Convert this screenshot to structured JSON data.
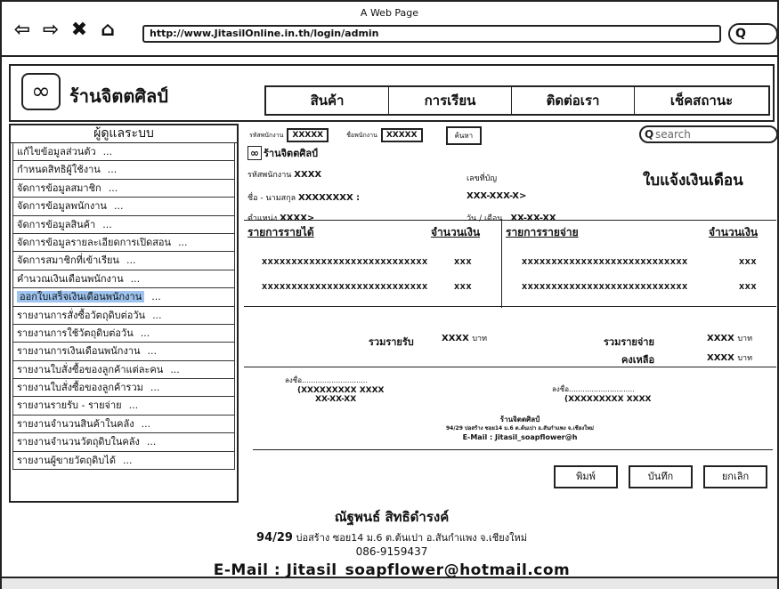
{
  "window": {
    "title": "A Web Page"
  },
  "browser": {
    "url": "http://www.JitasilOnline.in.th/login/admin",
    "back_icon": "back-arrow-icon",
    "forward_icon": "forward-arrow-icon",
    "close_icon": "close-icon",
    "home_icon": "home-icon",
    "search_glyph": "Q"
  },
  "header": {
    "logo_glyph": "∞",
    "shop_name": "ร้านจิตตศิลป์",
    "nav": [
      "สินค้า",
      "การเรียน",
      "ติดต่อเรา",
      "เช็คสถานะ"
    ]
  },
  "sidebar": {
    "title": "ผู้ดูแลระบบ",
    "items": [
      "แก้ไขข้อมูลส่วนตัว",
      "กำหนดสิทธิผู้ใช้งาน",
      "จัดการข้อมูลสมาชิก",
      "จัดการข้อมูลพนักงาน",
      "จัดการข้อมูลสินค้า",
      "จัดการข้อมูลรายละเอียดการเปิดสอน",
      "จัดการสมาชิกที่เข้าเรียน",
      "คำนวณเงินเดือนพนักงาน",
      "ออกใบเสร็จเงินเดือนพนักงาน",
      "รายงานการสั่งซื้อวัตถุดิบต่อวัน",
      "รายงานการใช้วัตถุดิบต่อวัน",
      "รายงานการเงินเดือนพนักงาน",
      "รายงานใบสั่งซื้อของลูกค้าแต่ละคน",
      "รายงานใบสั่งซื้อของลูกค้ารวม",
      "รายงานรายรับ - รายจ่าย",
      "รายงานจำนวนสินค้าในคลัง",
      "รายงานจำนวนวัตถุดิบในคลัง",
      "รายงานผู้ขายวัตถุดิบได้"
    ],
    "active_index": 8,
    "ellipsis": "..."
  },
  "filter": {
    "emp_id_label": "รหัสพนักงาน",
    "emp_id_value": "XXXXX",
    "emp_name_label": "ชื่อพนักงาน",
    "emp_name_value": "XXXXX",
    "button": "ค้นหา",
    "search_placeholder": "search"
  },
  "slip": {
    "logo_glyph": "∞",
    "shop_name": "ร้านจิตตศิลป์",
    "title": "ใบแจ้งเงินเดือน",
    "emp_id_label": "รหัสพนักงาน",
    "emp_id_value": "XXXX",
    "name_label": "ชื่อ - นามสกุล",
    "name_value": "XXXXXXXX :",
    "position_label": "ตำแหน่ง",
    "position_value": "XXXX>",
    "account_label": "เลขที่บัญ",
    "account_value": "XXX-XXX-X>",
    "date_label": "วัน / เดือน",
    "date_value": "XX-XX-XX",
    "income_header": "รายการรายได้",
    "income_amount_header": "จำนวนเงิน",
    "expense_header": "รายการรายจ่าย",
    "expense_amount_header": "จำนวนเงิน",
    "rows": [
      {
        "income": "XXXXXXXXXXXXXXXXXXXXXXXXXXXX",
        "income_amt": "XXX",
        "expense": "XXXXXXXXXXXXXXXXXXXXXXXXXXXX",
        "expense_amt": "XXX"
      },
      {
        "income": "XXXXXXXXXXXXXXXXXXXXXXXXXXXX",
        "income_amt": "XXX",
        "expense": "XXXXXXXXXXXXXXXXXXXXXXXXXXXX",
        "expense_amt": "XXX"
      }
    ],
    "total_income_label": "รวมรายรับ",
    "total_income_value": "XXXX",
    "total_expense_label": "รวมรายจ่าย",
    "total_expense_value": "XXXX",
    "balance_label": "คงเหลือ",
    "balance_value": "XXXX",
    "currency": "บาท",
    "sign_label": "ลงชื่อ.............................",
    "sign_left_name": "(XXXXXXXXX  XXXX",
    "sign_left_date": "XX-XX-XX",
    "sign_right_name": "(XXXXXXXXX  XXXX",
    "foot_shop": "ร้านจิตตศิลป์",
    "foot_addr": "94/29 บ่อสร้าง ซอย14 ม.6 ต.ต้นเปา อ.สันกำแพง จ.เชียงใหม่",
    "foot_email": "E-Mail : Jitasil_soapflower@h"
  },
  "actions": {
    "print": "พิมพ์",
    "save": "บันทึก",
    "cancel": "ยกเลิก"
  },
  "footer": {
    "owner": "ณัฐพนธ์ สิทธิดำรงค์",
    "addr_num": "94/29",
    "addr_text": "บ่อสร้าง ซอย14 ม.6 ต.ต้นเปา อ.สันกำแพง จ.เชียงใหม่",
    "phone": "086-9159437",
    "email": "E-Mail : Jitasil_soapflower@hotmail.com"
  }
}
